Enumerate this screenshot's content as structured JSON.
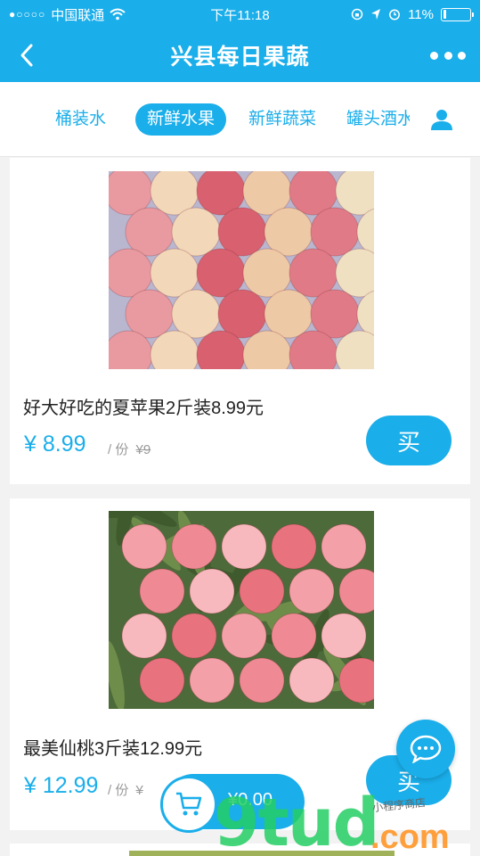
{
  "status_bar": {
    "signal_dots": "●○○○○",
    "carrier": "中国联通",
    "wifi_icon": "wifi-icon",
    "time": "下午11:18",
    "battery_percent": "11%",
    "battery_level": 0.11
  },
  "navbar": {
    "back_icon": "chevron-left-icon",
    "title": "兴县每日果蔬",
    "more_icon": "more-dots-icon"
  },
  "tabs": [
    {
      "label": "桶装水",
      "active": false
    },
    {
      "label": "新鲜水果",
      "active": true
    },
    {
      "label": "新鲜蔬菜",
      "active": false
    },
    {
      "label": "罐头酒水",
      "active": false
    }
  ],
  "products": [
    {
      "name": "好大好吃的夏苹果2斤装8.99元",
      "price": "¥ 8.99",
      "unit": "/ 份",
      "original_price": "¥9",
      "buy_label": "买",
      "image": "apples-photo"
    },
    {
      "name": "最美仙桃3斤装12.99元",
      "price": "¥ 12.99",
      "unit": "/ 份",
      "original_price": "¥",
      "buy_label": "买",
      "image": "peaches-photo"
    }
  ],
  "cart": {
    "total": "¥0.00",
    "icon": "cart-icon"
  },
  "chat": {
    "icon": "chat-bubble-icon"
  },
  "watermark": {
    "main": "9tud",
    "domain": ".com",
    "tag": "小程序商店"
  },
  "colors": {
    "accent": "#1aaeea",
    "text": "#222222",
    "muted": "#999999"
  }
}
